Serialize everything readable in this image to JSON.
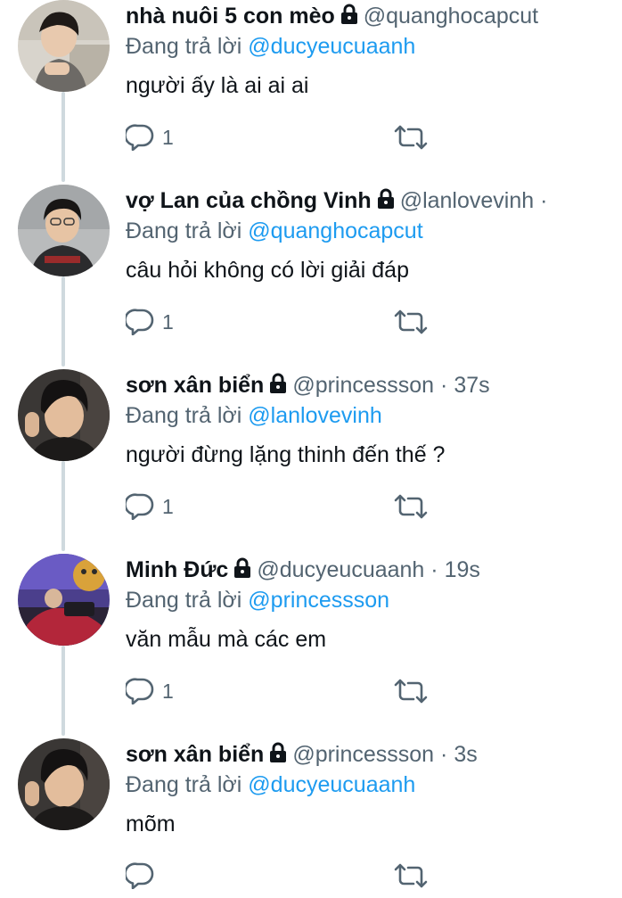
{
  "colors": {
    "text_primary": "#0f1419",
    "text_secondary": "#536471",
    "mention": "#1d9bf0",
    "thread_line": "#cfd9de"
  },
  "tweets": [
    {
      "display_name": "nhà nuôi 5 con mèo",
      "locked": true,
      "handle": "@quanghocapcut",
      "dot": "",
      "time": "",
      "replying_label": "Đang trả lời",
      "replying_to": "@ducyeucuaanh",
      "text": "người ấy là ai ai ai",
      "reply_count": "1",
      "reply_icon": "reply-bubble-icon",
      "retweet_icon": "retweet-icon"
    },
    {
      "display_name": "vợ Lan của chồng Vinh",
      "locked": true,
      "handle": "@lanlovevinh",
      "dot": "·",
      "time": "",
      "replying_label": "Đang trả lời",
      "replying_to": "@quanghocapcut",
      "text": "câu hỏi không có lời giải đáp",
      "reply_count": "1",
      "reply_icon": "reply-bubble-icon",
      "retweet_icon": "retweet-icon"
    },
    {
      "display_name": "sơn xân biển",
      "locked": true,
      "handle": "@princessson",
      "dot": "·",
      "time": "37s",
      "replying_label": "Đang trả lời",
      "replying_to": "@lanlovevinh",
      "text": "người đừng lặng thinh đến thế ?",
      "reply_count": "1",
      "reply_icon": "reply-bubble-icon",
      "retweet_icon": "retweet-icon"
    },
    {
      "display_name": "Minh Đức",
      "locked": true,
      "handle": "@ducyeucuaanh",
      "dot": "·",
      "time": "19s",
      "replying_label": "Đang trả lời",
      "replying_to": "@princessson",
      "text": "văn mẫu mà các em",
      "reply_count": "1",
      "reply_icon": "reply-bubble-icon",
      "retweet_icon": "retweet-icon"
    },
    {
      "display_name": "sơn xân biển",
      "locked": true,
      "handle": "@princessson",
      "dot": "·",
      "time": "3s",
      "replying_label": "Đang trả lời",
      "replying_to": "@ducyeucuaanh",
      "text": "mõm",
      "reply_count": "",
      "reply_icon": "reply-bubble-icon",
      "retweet_icon": "retweet-icon"
    }
  ]
}
